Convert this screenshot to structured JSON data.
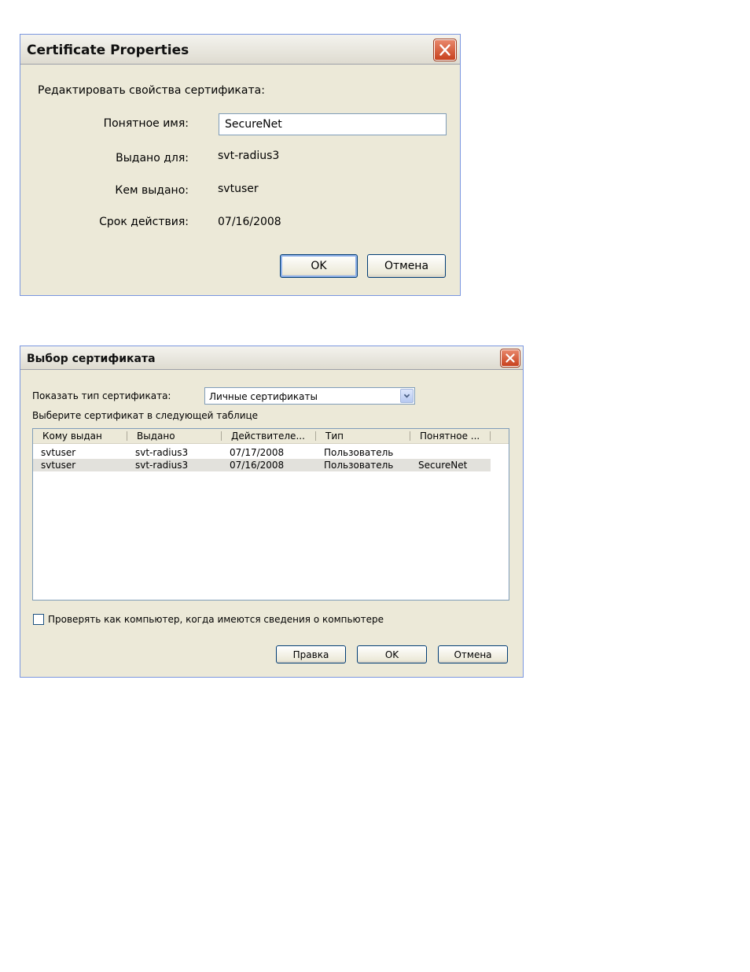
{
  "dialog1": {
    "title": "Certificate Properties",
    "heading": "Редактировать свойства сертификата:",
    "fields": {
      "friendly_name_label": "Понятное имя:",
      "friendly_name_value": "SecureNet",
      "issued_to_label": "Выдано для:",
      "issued_to_value": "svt-radius3",
      "issued_by_label": "Кем выдано:",
      "issued_by_value": "svtuser",
      "expiry_label": "Срок действия:",
      "expiry_value": "07/16/2008"
    },
    "buttons": {
      "ok": "OK",
      "cancel": "Отмена"
    }
  },
  "dialog2": {
    "title": "Выбор сертификата",
    "show_type_label": "Показать тип сертификата:",
    "show_type_value": "Личные сертификаты",
    "select_hint": "Выберите сертификат в следующей таблице",
    "columns": [
      "Кому выдан",
      "Выдано",
      "Действителе...",
      "Тип",
      "Понятное ..."
    ],
    "rows": [
      [
        "svtuser",
        "svt-radius3",
        "07/17/2008",
        "Пользователь",
        ""
      ],
      [
        "svtuser",
        "svt-radius3",
        "07/16/2008",
        "Пользователь",
        "SecureNet"
      ]
    ],
    "selected_row": 1,
    "checkbox_label": "Проверять как компьютер, когда имеются сведения о компьютере",
    "buttons": {
      "edit": "Правка",
      "ok": "OK",
      "cancel": "Отмена"
    }
  },
  "colors": {
    "window_bg": "#ece9d8",
    "close_red": "#c8421e",
    "frame_blue": "#7a96df"
  },
  "icons": {
    "close": "close-icon",
    "dropdown": "chevron-down-icon"
  }
}
